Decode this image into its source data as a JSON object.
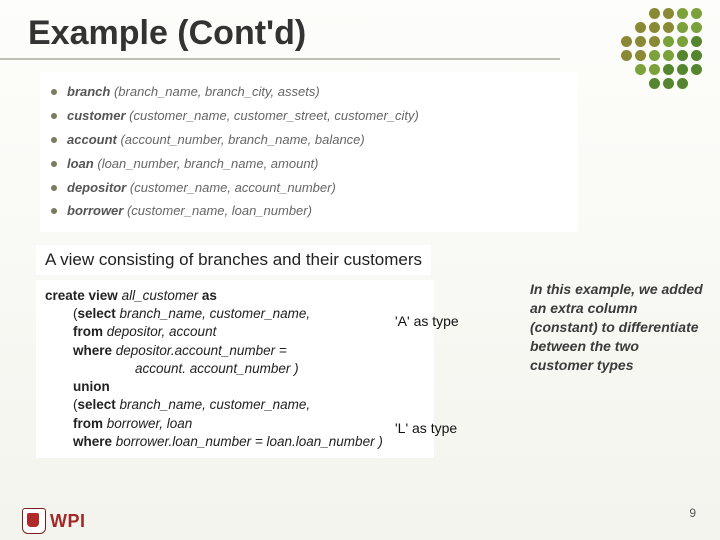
{
  "title": "Example (Cont'd)",
  "schemas": [
    {
      "name": "branch",
      "attrs": "(branch_name, branch_city, assets)"
    },
    {
      "name": "customer",
      "attrs": "(customer_name, customer_street, customer_city)"
    },
    {
      "name": "account",
      "attrs": "(account_number, branch_name, balance)"
    },
    {
      "name": "loan",
      "attrs": "(loan_number, branch_name, amount)"
    },
    {
      "name": "depositor",
      "attrs": "(customer_name, account_number)"
    },
    {
      "name": "borrower",
      "attrs": "(customer_name, loan_number)"
    }
  ],
  "view_caption": "A view consisting of branches and their customers",
  "sql": {
    "l1_kw1": "create view ",
    "l1_name": "all_customer",
    "l1_kw2": " as",
    "l2_open": "(",
    "l2_kw": "select ",
    "l2_cols": "branch_name, customer_name,",
    "l3_kw": "from ",
    "l3_tables": "depositor, account",
    "l4_kw": "where ",
    "l4_pred_a": "depositor.account_number =",
    "l4_pred_b": "account. account_number )",
    "l5_kw": "union",
    "l6_open": "(",
    "l6_kw": "select ",
    "l6_cols": "branch_name, customer_name,",
    "l7_kw": "from ",
    "l7_tables": "borrower, loan",
    "l8_kw": "where ",
    "l8_pred": "borrower.loan_number = loan.loan_number )"
  },
  "addendum1": "'A' as type",
  "addendum2": "'L' as type",
  "side_note": "In this example, we added an extra column (constant) to differentiate between the two customer types",
  "page_number": "9",
  "logo_text": "WPI"
}
